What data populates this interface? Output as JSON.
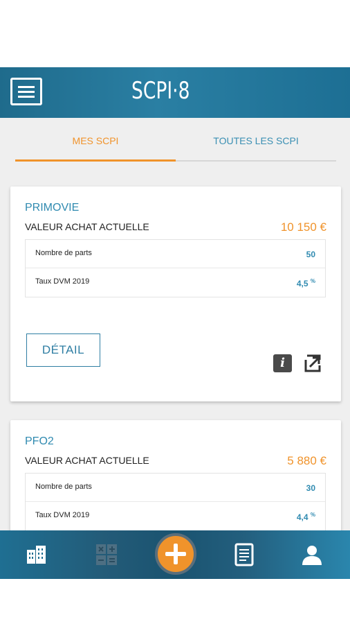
{
  "header": {
    "logo_text": "SCPI·8"
  },
  "tabs": [
    {
      "label": "MES SCPI",
      "active": true
    },
    {
      "label": "TOUTES LES SCPI",
      "active": false
    }
  ],
  "cards": [
    {
      "name": "PRIMOVIE",
      "value_label": "VALEUR ACHAT ACTUELLE",
      "value": "10 150 €",
      "rows": [
        {
          "label": "Nombre de parts",
          "value": "50",
          "suffix": ""
        },
        {
          "label": "Taux DVM 2019",
          "value": "4,5",
          "suffix": "%"
        }
      ],
      "detail_label": "DÉTAIL"
    },
    {
      "name": "PFO2",
      "value_label": "VALEUR ACHAT ACTUELLE",
      "value": "5 880 €",
      "rows": [
        {
          "label": "Nombre de parts",
          "value": "30",
          "suffix": ""
        },
        {
          "label": "Taux DVM 2019",
          "value": "4,4",
          "suffix": "%"
        }
      ]
    }
  ],
  "icons": {
    "menu": "hamburger-menu-icon",
    "info": "info-icon",
    "share": "external-link-icon",
    "nav": [
      "buildings-icon",
      "calculator-icon",
      "add-icon",
      "document-icon",
      "user-icon"
    ]
  },
  "colors": {
    "accent": "#f0932b",
    "primary": "#2f8ab0",
    "bar": "#1f6b8c"
  }
}
